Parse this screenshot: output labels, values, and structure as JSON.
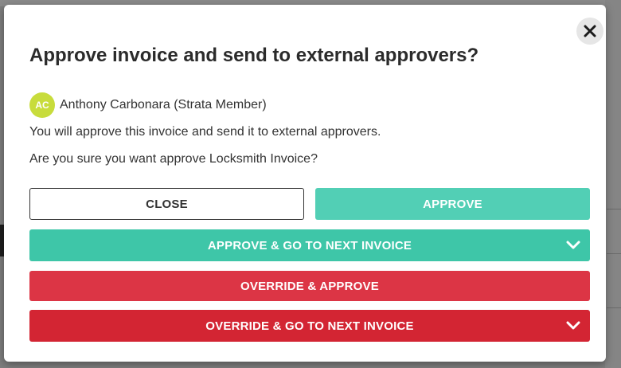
{
  "modal": {
    "title": "Approve invoice and send to external approvers?",
    "user": {
      "initials": "AC",
      "name": "Anthony Carbonara (Strata Member)"
    },
    "message": "You will approve this invoice and send it to external approvers.",
    "question": "Are you sure you want approve Locksmith Invoice?",
    "buttons": {
      "close": "CLOSE",
      "approve": "APPROVE",
      "approve_next": "APPROVE & GO TO NEXT INVOICE",
      "override_approve": "OVERRIDE & APPROVE",
      "override_next": "OVERRIDE & GO TO NEXT INVOICE"
    }
  },
  "colors": {
    "approve": "#52cfb5",
    "approve_next": "#3ec6a8",
    "override": "#dc3545",
    "override_next": "#d32533",
    "avatar": "#c8dc3c"
  },
  "icons": {
    "close": "close-icon",
    "dropdown": "chevron-down-icon"
  }
}
